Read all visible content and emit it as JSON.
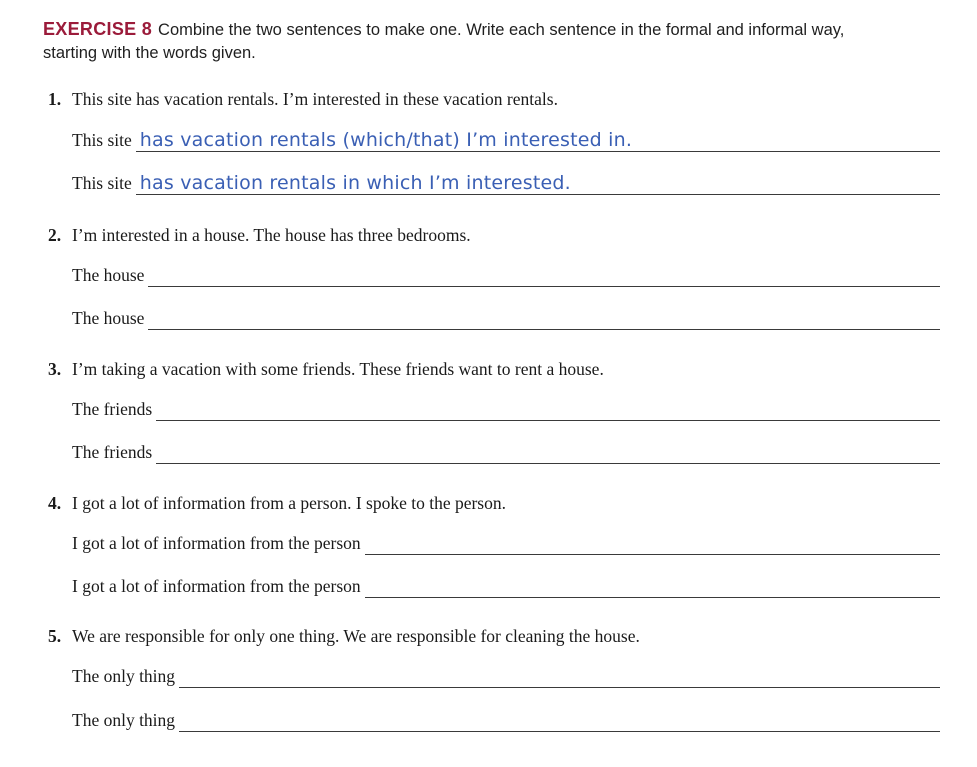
{
  "exercise": {
    "label": "EXERCISE 8",
    "instructions": "Combine the two sentences to make one. Write each sentence in the formal and informal way, starting with the words given."
  },
  "items": [
    {
      "number": "1.",
      "prompt": "This site has vacation rentals. I’m interested in these vacation rentals.",
      "answers": [
        {
          "stem": "This site",
          "response": "has vacation rentals (which/that) I’m interested in."
        },
        {
          "stem": "This site",
          "response": "has vacation rentals in which I’m interested."
        }
      ]
    },
    {
      "number": "2.",
      "prompt": "I’m interested in a house. The house has three bedrooms.",
      "answers": [
        {
          "stem": "The house",
          "response": ""
        },
        {
          "stem": "The house",
          "response": ""
        }
      ]
    },
    {
      "number": "3.",
      "prompt": "I’m taking a vacation with some friends. These friends want to rent a house.",
      "answers": [
        {
          "stem": "The friends",
          "response": ""
        },
        {
          "stem": "The friends",
          "response": ""
        }
      ]
    },
    {
      "number": "4.",
      "prompt": "I got a lot of information from a person. I spoke to the person.",
      "answers": [
        {
          "stem": "I got a lot of information from the person",
          "response": ""
        },
        {
          "stem": "I got a lot of information from the person",
          "response": ""
        }
      ]
    },
    {
      "number": "5.",
      "prompt": "We are responsible for only one thing. We are responsible for cleaning the house.",
      "answers": [
        {
          "stem": "The only thing",
          "response": ""
        },
        {
          "stem": "The only thing",
          "response": ""
        }
      ]
    }
  ]
}
